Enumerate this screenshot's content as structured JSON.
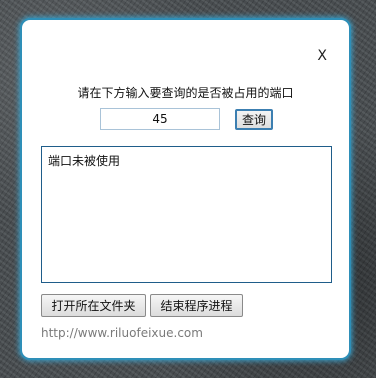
{
  "dialog": {
    "close_label": "X",
    "prompt": "请在下方输入要查询的是否被占用的端口",
    "port_value": "45",
    "query_label": "查询",
    "result_text": "端口未被使用",
    "open_folder_label": "打开所在文件夹",
    "end_process_label": "结束程序进程",
    "website": "http://www.riluofeixue.com"
  },
  "colors": {
    "dialog_border": "#2e8fb8",
    "link": "#7a7a7a"
  }
}
